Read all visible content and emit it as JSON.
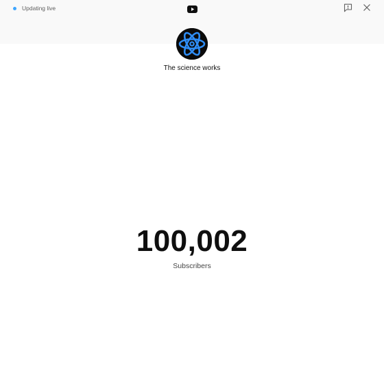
{
  "header": {
    "status_text": "Updating live",
    "logo_icon": "youtube-play-icon",
    "report_icon": "report-flag-icon",
    "close_icon": "close-icon"
  },
  "channel": {
    "avatar_icon": "atom-icon",
    "name": "The science works"
  },
  "stats": {
    "subscriber_count": "100,002",
    "subscriber_label": "Subscribers"
  },
  "colors": {
    "live_dot": "#3ea6ff",
    "logo": "#0f0f0f",
    "atom": "#2f8df5",
    "avatar_bg": "#0b0b0b"
  }
}
